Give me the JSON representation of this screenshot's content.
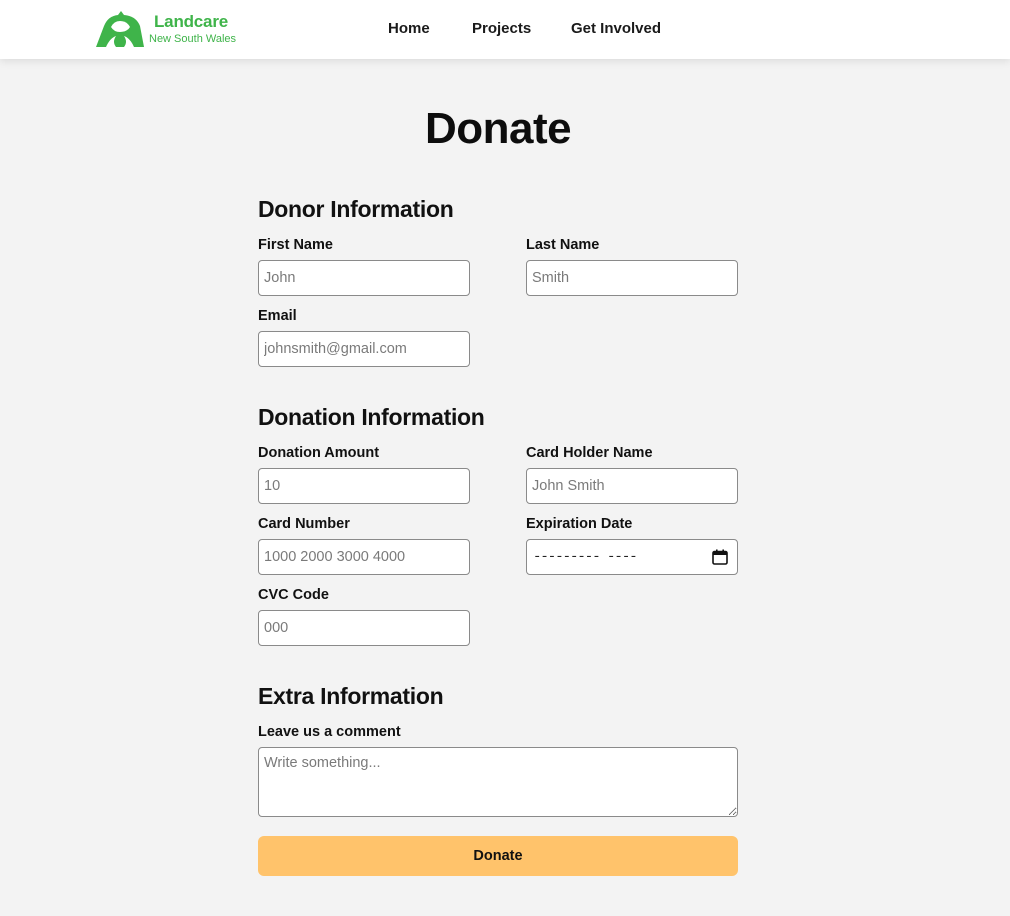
{
  "brand": {
    "name": "Landcare",
    "subtitle": "New South Wales",
    "color": "#3fb44a",
    "logo_icon": "hands-around-australia-icon"
  },
  "nav": {
    "items": [
      {
        "label": "Home"
      },
      {
        "label": "Projects"
      },
      {
        "label": "Get Involved"
      }
    ]
  },
  "page": {
    "title": "Donate"
  },
  "donor_section": {
    "heading": "Donor Information",
    "first_name": {
      "label": "First Name",
      "placeholder": "John",
      "value": ""
    },
    "last_name": {
      "label": "Last Name",
      "placeholder": "Smith",
      "value": ""
    },
    "email": {
      "label": "Email",
      "placeholder": "johnsmith@gmail.com",
      "value": ""
    }
  },
  "donation_section": {
    "heading": "Donation Information",
    "amount": {
      "label": "Donation Amount",
      "placeholder": "10",
      "value": ""
    },
    "card_holder": {
      "label": "Card Holder Name",
      "placeholder": "John Smith",
      "value": ""
    },
    "card_number": {
      "label": "Card Number",
      "placeholder": "1000 2000 3000 4000",
      "value": ""
    },
    "expiration": {
      "label": "Expiration Date",
      "display": "--------- ----",
      "icon": "calendar-icon"
    },
    "cvc": {
      "label": "CVC Code",
      "placeholder": "000",
      "value": ""
    }
  },
  "extra_section": {
    "heading": "Extra Information",
    "comment": {
      "label": "Leave us a comment",
      "placeholder": "Write something..."
    }
  },
  "submit": {
    "label": "Donate",
    "color": "#ffc36b"
  }
}
